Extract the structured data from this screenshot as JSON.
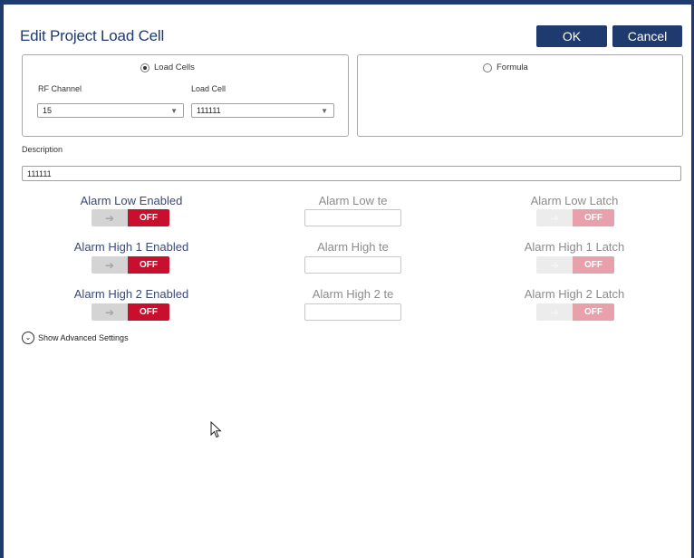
{
  "dialog": {
    "title": "Edit Project Load Cell",
    "ok_label": "OK",
    "cancel_label": "Cancel"
  },
  "source": {
    "load_cells_label": "Load Cells",
    "load_cells_selected": true,
    "formula_label": "Formula",
    "formula_selected": false,
    "rf_channel_label": "RF Channel",
    "rf_channel_value": "15",
    "load_cell_label": "Load Cell",
    "load_cell_value": "111111"
  },
  "description": {
    "label": "Description",
    "value": "111111"
  },
  "alarms": {
    "rows": [
      {
        "enabled_label": "Alarm Low Enabled",
        "enabled_state": "OFF",
        "value_label": "Alarm Low te",
        "latch_label": "Alarm Low Latch",
        "latch_state": "OFF"
      },
      {
        "enabled_label": "Alarm High 1 Enabled",
        "enabled_state": "OFF",
        "value_label": "Alarm High te",
        "latch_label": "Alarm High 1 Latch",
        "latch_state": "OFF"
      },
      {
        "enabled_label": "Alarm High 2 Enabled",
        "enabled_state": "OFF",
        "value_label": "Alarm High 2 te",
        "latch_label": "Alarm High 2 Latch",
        "latch_state": "OFF"
      }
    ]
  },
  "advanced": {
    "label": "Show Advanced Settings"
  },
  "colors": {
    "primary": "#1f3a6e",
    "toggle_off": "#c8102e",
    "toggle_off_disabled": "#e8a0aa"
  }
}
